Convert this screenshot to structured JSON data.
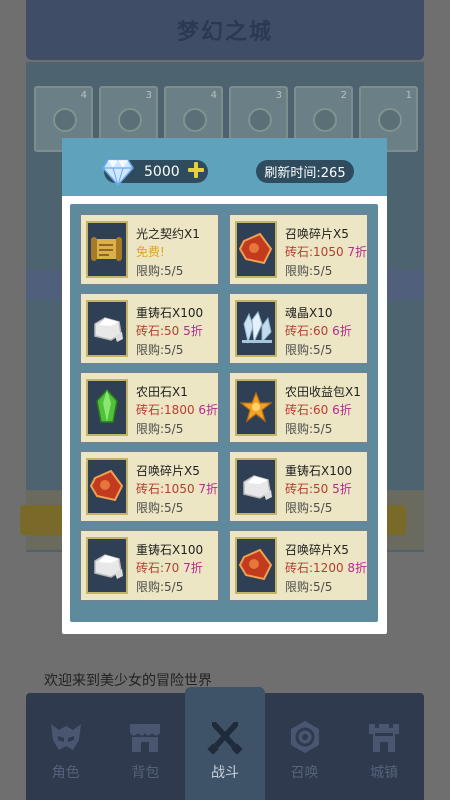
{
  "background": {
    "title": "梦幻之城",
    "slot_counts": [
      "4",
      "3",
      "4",
      "3",
      "2",
      "1"
    ],
    "scroll_text": "欢迎来到美少女的冒险世界"
  },
  "modal": {
    "gem_count": "5000",
    "refresh_label": "刷新时间:265",
    "items": [
      {
        "name": "光之契约X1",
        "price": "免费!",
        "discount": "",
        "limit": "限购:5/5",
        "icon": "scroll-icon"
      },
      {
        "name": "召唤碎片X5",
        "price": "砖石:1050",
        "discount": "7折",
        "limit": "限购:5/5",
        "icon": "summon-shard-icon"
      },
      {
        "name": "重铸石X100",
        "price": "砖石:50",
        "discount": "5折",
        "limit": "限购:5/5",
        "icon": "reforge-stone-icon"
      },
      {
        "name": "魂晶X10",
        "price": "砖石:60",
        "discount": "6折",
        "limit": "限购:5/5",
        "icon": "soul-crystal-icon"
      },
      {
        "name": "农田石X1",
        "price": "砖石:1800",
        "discount": "6折",
        "limit": "限购:5/5",
        "icon": "farm-stone-icon"
      },
      {
        "name": "农田收益包X1",
        "price": "砖石:60",
        "discount": "6折",
        "limit": "限购:5/5",
        "icon": "farm-income-icon"
      },
      {
        "name": "召唤碎片X5",
        "price": "砖石:1050",
        "discount": "7折",
        "limit": "限购:5/5",
        "icon": "summon-shard-icon"
      },
      {
        "name": "重铸石X100",
        "price": "砖石:50",
        "discount": "5折",
        "limit": "限购:5/5",
        "icon": "reforge-stone-icon"
      },
      {
        "name": "重铸石X100",
        "price": "砖石:70",
        "discount": "7折",
        "limit": "限购:5/5",
        "icon": "reforge-stone-icon"
      },
      {
        "name": "召唤碎片X5",
        "price": "砖石:1200",
        "discount": "8折",
        "limit": "限购:5/5",
        "icon": "summon-shard-icon"
      }
    ]
  },
  "nav": [
    {
      "label": "角色",
      "icon": "helmet-icon"
    },
    {
      "label": "背包",
      "icon": "shop-icon"
    },
    {
      "label": "战斗",
      "icon": "crossed-swords-icon"
    },
    {
      "label": "召唤",
      "icon": "portal-icon"
    },
    {
      "label": "城镇",
      "icon": "castle-icon"
    }
  ],
  "colors": {
    "modal_header": "#5ea3bb",
    "shop_bg": "#5e8a9e",
    "card_bg": "#ece6c4",
    "price_red": "#b63e2f",
    "discount_magenta": "#b32b8f",
    "free_gold": "#e0a227"
  }
}
